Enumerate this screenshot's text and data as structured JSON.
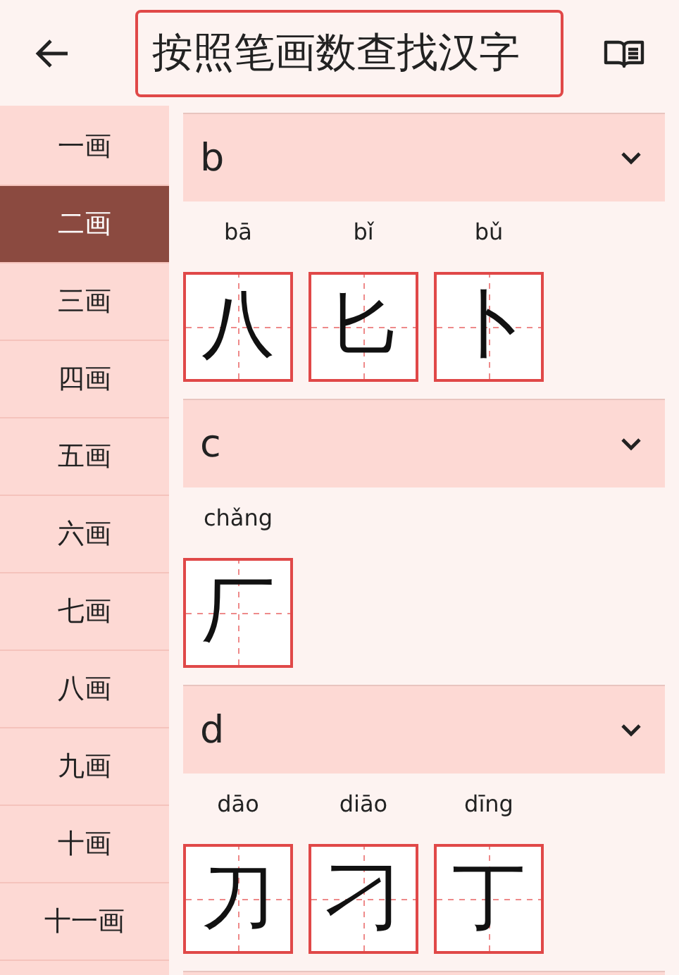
{
  "header": {
    "title": "按照笔画数查找汉字"
  },
  "strokes": [
    {
      "label": "一画",
      "selected": false
    },
    {
      "label": "二画",
      "selected": true
    },
    {
      "label": "三画",
      "selected": false
    },
    {
      "label": "四画",
      "selected": false
    },
    {
      "label": "五画",
      "selected": false
    },
    {
      "label": "六画",
      "selected": false
    },
    {
      "label": "七画",
      "selected": false
    },
    {
      "label": "八画",
      "selected": false
    },
    {
      "label": "九画",
      "selected": false
    },
    {
      "label": "十画",
      "selected": false
    },
    {
      "label": "十一画",
      "selected": false
    }
  ],
  "groups": [
    {
      "letter": "b",
      "chars": [
        {
          "pinyin": "bā",
          "char": "八"
        },
        {
          "pinyin": "bǐ",
          "char": "匕"
        },
        {
          "pinyin": "bǔ",
          "char": "卜"
        }
      ]
    },
    {
      "letter": "c",
      "chars": [
        {
          "pinyin": "chǎng",
          "char": "厂"
        }
      ]
    },
    {
      "letter": "d",
      "chars": [
        {
          "pinyin": "dāo",
          "char": "刀"
        },
        {
          "pinyin": "diāo",
          "char": "刁"
        },
        {
          "pinyin": "dīng",
          "char": "丁"
        }
      ]
    }
  ]
}
